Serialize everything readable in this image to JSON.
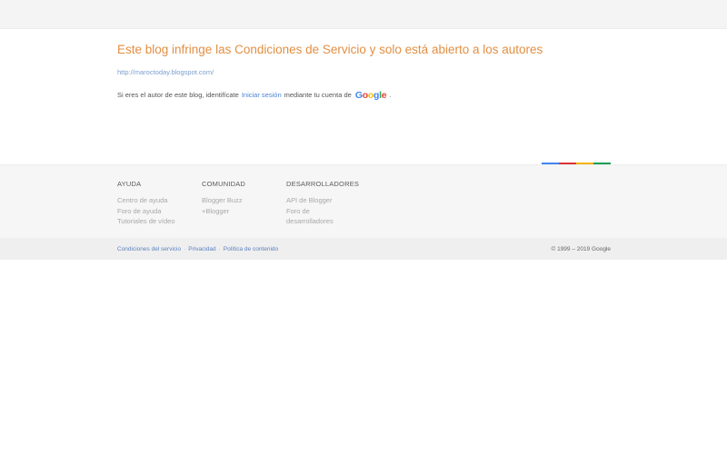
{
  "main": {
    "title": "Este blog infringe las Condiciones de Servicio y solo está abierto a los autores",
    "blog_url": "http://maroctoday.blogspot.com/",
    "notice_prefix": "Si eres el autor de este blog, identifícate",
    "signin_link": "Iniciar sesión",
    "notice_middle": "mediante tu cuenta de",
    "google_logo": {
      "letters": [
        "G",
        "o",
        "o",
        "g",
        "l",
        "e"
      ],
      "colors": [
        "#4285F4",
        "#EA4335",
        "#FBBC05",
        "#4285F4",
        "#34A853",
        "#EA4335"
      ]
    },
    "notice_suffix": "."
  },
  "stripe_colors": [
    "#4285F4",
    "#DB3236",
    "#F4B400",
    "#0F9D58"
  ],
  "footer": {
    "columns": [
      {
        "heading": "AYUDA",
        "links": [
          "Centro de ayuda",
          "Foro de ayuda",
          "Tutoriales de vídeo"
        ]
      },
      {
        "heading": "COMUNIDAD",
        "links": [
          "Blogger Buzz",
          "+Blogger"
        ]
      },
      {
        "heading": "DESARROLLADORES",
        "links": [
          "API de Blogger",
          "Foro de",
          "desarrolladores"
        ]
      }
    ]
  },
  "subfooter": {
    "links": [
      "Condiciones del servicio",
      "Privacidad",
      "Política de contenido"
    ],
    "separator": "·",
    "copyright": "© 1999 – 2019 Google"
  }
}
